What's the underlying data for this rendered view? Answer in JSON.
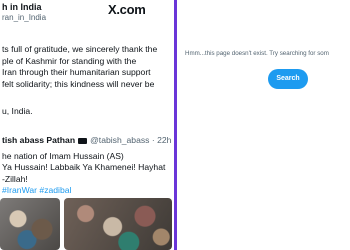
{
  "tweet": {
    "display_name": "h in India",
    "handle": "ran_in_India",
    "brand": "X.com",
    "body_lines": [
      "ts full of gratitude, we sincerely thank the",
      "ple of Kashmir for standing with the",
      "Iran through their humanitarian support",
      "felt solidarity; this kindness will never be"
    ],
    "closing": "u, India.",
    "quoted": {
      "name": "tish abass Pathan",
      "handle_time": "@tabish_abass · 22h",
      "body_lines": [
        "he nation of Imam Hussain (AS)",
        "Ya Hussain! Labbaik Ya Khamenei! Hayhat",
        "-Zillah!"
      ],
      "hashtags": "#IranWar #zadibal"
    }
  },
  "error_page": {
    "message": "Hmm...this page doesn't exist. Try searching for som",
    "search_button_label": "Search"
  },
  "colors": {
    "divider": "#6a35d8",
    "accent": "#1d9bf0",
    "muted_text": "#536471"
  }
}
